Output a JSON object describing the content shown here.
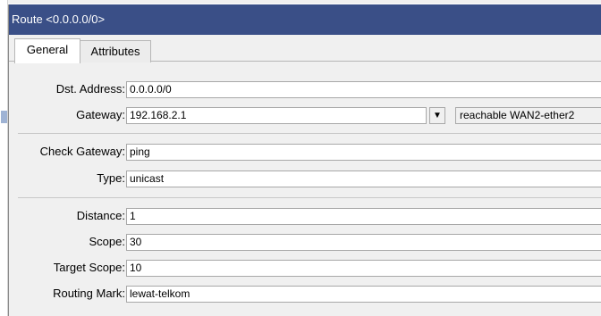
{
  "window": {
    "title": "Route <0.0.0.0/0>"
  },
  "tabs": [
    {
      "label": "General",
      "active": true
    },
    {
      "label": "Attributes",
      "active": false
    }
  ],
  "fields": {
    "dst_address": {
      "label": "Dst. Address:",
      "value": "0.0.0.0/0"
    },
    "gateway": {
      "label": "Gateway:",
      "value": "192.168.2.1",
      "status": "reachable WAN2-ether2",
      "dropdown_icon": "dropdown-icon"
    },
    "check_gateway": {
      "label": "Check Gateway:",
      "value": "ping"
    },
    "type": {
      "label": "Type:",
      "value": "unicast"
    },
    "distance": {
      "label": "Distance:",
      "value": "1"
    },
    "scope": {
      "label": "Scope:",
      "value": "30"
    },
    "target_scope": {
      "label": "Target Scope:",
      "value": "10"
    },
    "routing_mark": {
      "label": "Routing Mark:",
      "value": "lewat-telkom"
    }
  },
  "colors": {
    "titlebar": "#3a4f87",
    "panel": "#f0f0f0"
  }
}
